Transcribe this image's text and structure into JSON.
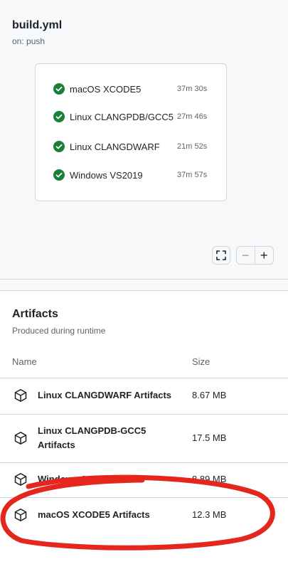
{
  "workflow": {
    "title": "build.yml",
    "trigger": "on: push",
    "jobs": [
      {
        "name": "macOS XCODE5",
        "duration": "37m 30s",
        "status": "success"
      },
      {
        "name": "Linux CLANGPDB/GCC5",
        "duration": "27m 46s",
        "status": "success"
      },
      {
        "name": "Linux CLANGDWARF",
        "duration": "21m 52s",
        "status": "success"
      },
      {
        "name": "Windows VS2019",
        "duration": "37m 57s",
        "status": "success"
      }
    ],
    "controls": {
      "fullscreen_icon": "fullscreen-icon",
      "zoom_out": "−",
      "zoom_in": "+"
    }
  },
  "artifacts": {
    "title": "Artifacts",
    "subtitle": "Produced during runtime",
    "columns": {
      "name": "Name",
      "size": "Size"
    },
    "items": [
      {
        "name": "Linux CLANGDWARF Artifacts",
        "size": "8.67 MB",
        "icon": "package-icon"
      },
      {
        "name": "Linux CLANGPDB-GCC5 Artifacts",
        "size": "17.5 MB",
        "icon": "package-icon"
      },
      {
        "name": "Windows Artifacts",
        "size": "8.89 MB",
        "icon": "package-icon"
      },
      {
        "name": "macOS XCODE5 Artifacts",
        "size": "12.3 MB",
        "icon": "package-icon"
      }
    ]
  },
  "colors": {
    "success": "#1a7f37",
    "annotation": "#e4261c",
    "panel_bg": "#f6f8fa",
    "border": "#d0d7de"
  }
}
